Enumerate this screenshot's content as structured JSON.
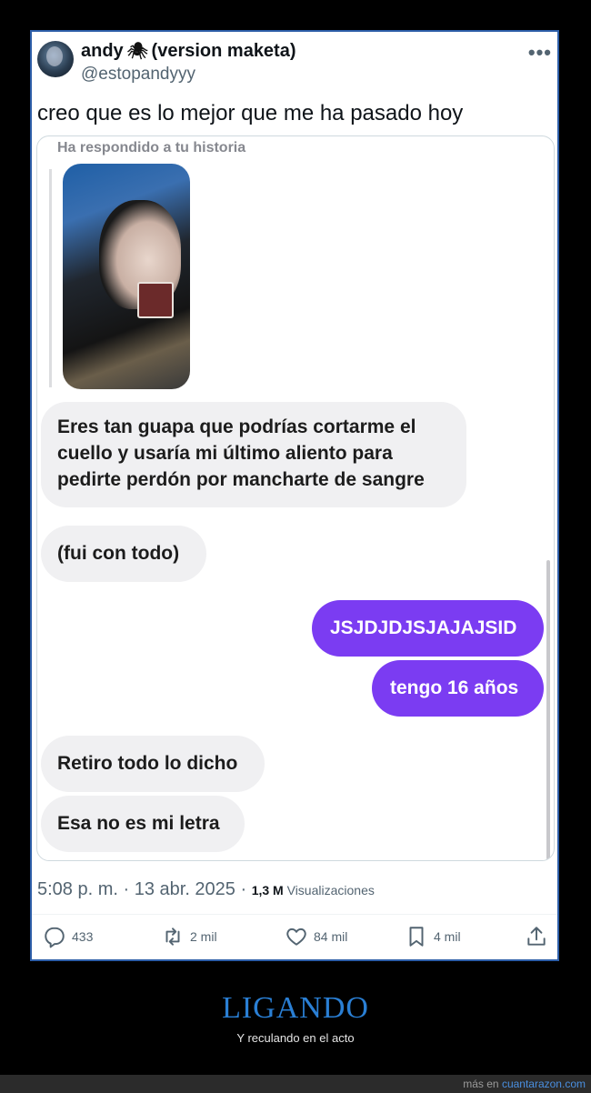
{
  "tweet": {
    "display_name_prefix": "andy",
    "display_name_suffix": "(version maketa)",
    "handle": "@estopandyyy",
    "text": "creo que es lo mejor que me ha pasado hoy",
    "timestamp": "5:08 p. m. · 13 abr. 2025 · ",
    "views_count": "1,3 M",
    "views_label": " Visualizaciones",
    "actions": {
      "replies": "433",
      "retweets": "2 mil",
      "likes": "84 mil",
      "bookmarks": "4 mil"
    }
  },
  "chat": {
    "story_label": "Ha respondido a tu historia",
    "messages": [
      {
        "side": "left",
        "text": "Eres tan guapa que podrías cortarme el cuello y usaría mi último aliento para pedirte perdón por mancharte de sangre"
      },
      {
        "side": "left",
        "text": "(fui con todo)"
      },
      {
        "side": "right",
        "text": "JSJDJDJSJAJAJSID"
      },
      {
        "side": "right",
        "text": "tengo 16 años"
      },
      {
        "side": "left",
        "text": "Retiro todo lo dicho"
      },
      {
        "side": "left",
        "text": "Esa no es mi letra"
      }
    ],
    "colors": {
      "sent_bubble": "#7b3cf2",
      "received_bubble": "#f0f0f2"
    }
  },
  "footer": {
    "title": "LIGANDO",
    "subtitle": "Y reculando en el acto",
    "credit_prefix": "más en ",
    "credit_site": "cuantarazon.com"
  },
  "icons": [
    "spider-icon",
    "more-icon",
    "reply-icon",
    "retweet-icon",
    "like-icon",
    "bookmark-icon",
    "share-icon"
  ]
}
